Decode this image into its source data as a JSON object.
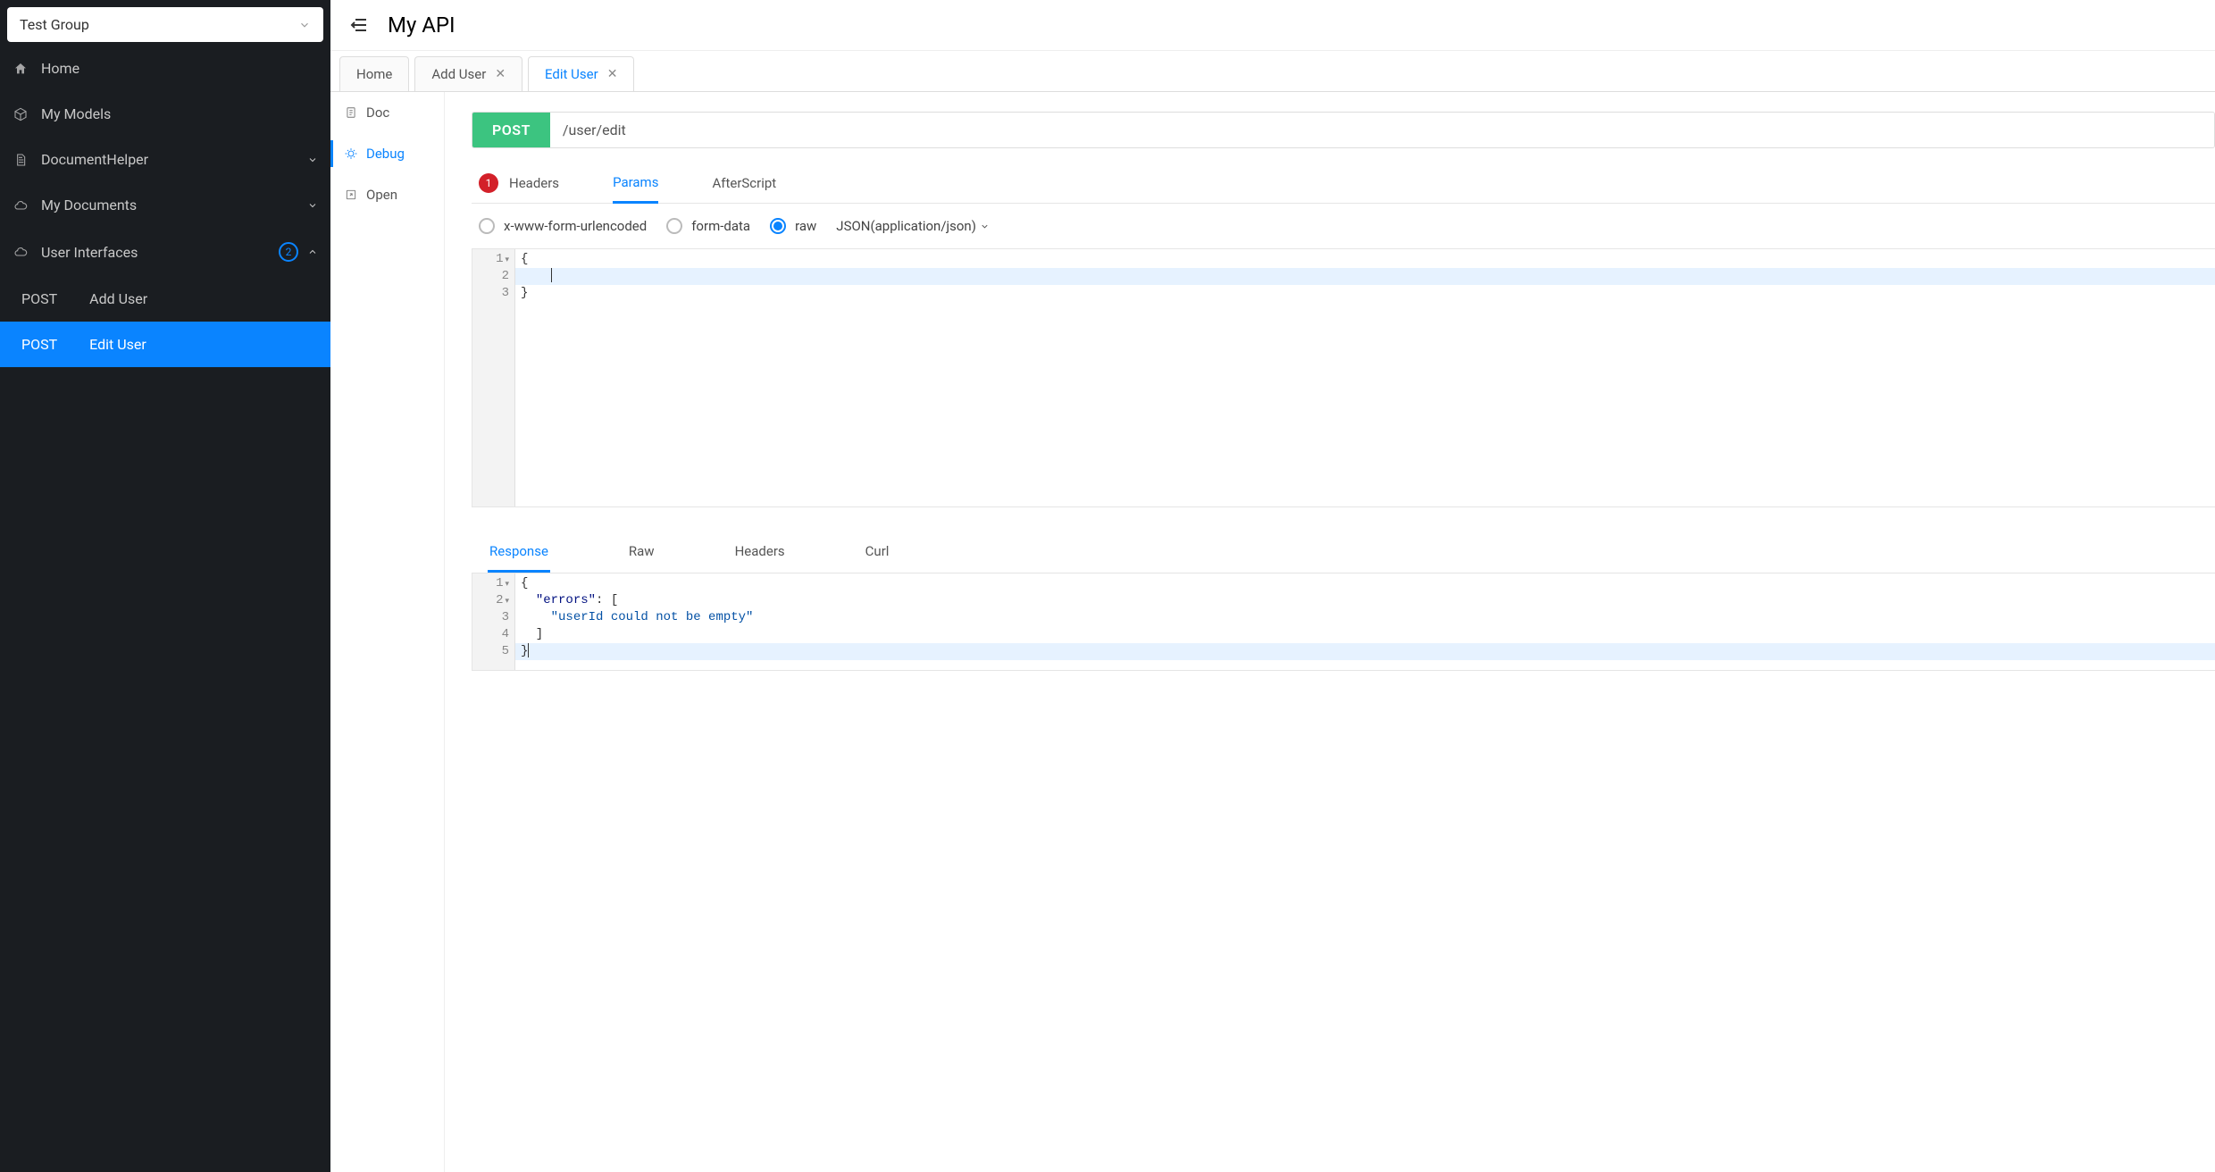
{
  "sidebar": {
    "group_selector": "Test Group",
    "items": {
      "home": "Home",
      "models": "My Models",
      "dochelper": "DocumentHelper",
      "mydocs": "My Documents",
      "ui": "User Interfaces",
      "ui_badge": "2"
    },
    "sub": {
      "add": {
        "method": "POST",
        "label": "Add User"
      },
      "edit": {
        "method": "POST",
        "label": "Edit User"
      }
    }
  },
  "header": {
    "title": "My API"
  },
  "tabs": {
    "home": "Home",
    "add": "Add User",
    "edit": "Edit User"
  },
  "tool_col": {
    "doc": "Doc",
    "debug": "Debug",
    "open": "Open"
  },
  "request": {
    "method": "POST",
    "url": "/user/edit",
    "tabs": {
      "headers": "Headers",
      "headers_badge": "1",
      "params": "Params",
      "afterscript": "AfterScript"
    },
    "encoding": {
      "form_url": "x-www-form-urlencoded",
      "form_data": "form-data",
      "raw": "raw",
      "content_type": "JSON(application/json)"
    },
    "body_lines": [
      "{",
      "    ",
      "}"
    ],
    "cursor_line": 2
  },
  "response": {
    "tabs": {
      "response": "Response",
      "raw": "Raw",
      "headers": "Headers",
      "curl": "Curl"
    },
    "json": {
      "key_errors": "\"errors\"",
      "val_msg": "\"userId could not be empty\"",
      "lines": {
        "l1": "{",
        "l2_pre": "  ",
        "l2_post": ": [",
        "l3_pre": "    ",
        "l4": "  ]",
        "l5": "}"
      }
    },
    "cursor_line": 5
  }
}
